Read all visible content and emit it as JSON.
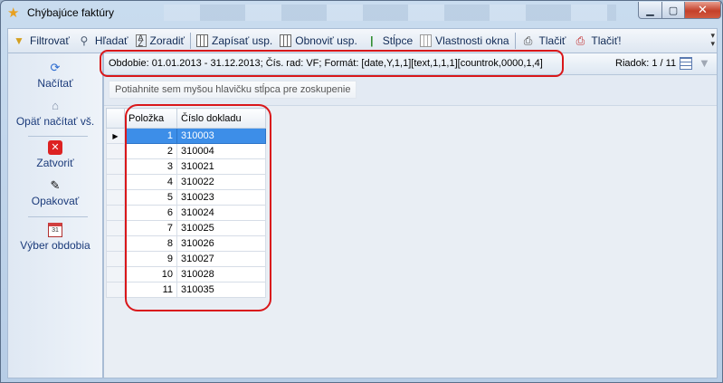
{
  "window": {
    "title": "Chýbajúce faktúry"
  },
  "toolbar": {
    "items": [
      {
        "label": "Filtrovať",
        "icon": "filter-icon"
      },
      {
        "label": "Hľadať",
        "icon": "search-icon"
      },
      {
        "label": "Zoradiť",
        "icon": "sort-icon"
      },
      {
        "label": "Zapísať usp.",
        "icon": "save-layout-icon"
      },
      {
        "label": "Obnoviť usp.",
        "icon": "restore-layout-icon"
      },
      {
        "label": "Stĺpce",
        "icon": "columns-icon"
      },
      {
        "label": "Vlastnosti okna",
        "icon": "window-properties-icon"
      },
      {
        "label": "Tlačiť",
        "icon": "print-icon"
      },
      {
        "label": "Tlačiť!",
        "icon": "print-direct-icon"
      }
    ]
  },
  "sidebar": {
    "items": [
      {
        "label": "Načítať",
        "icon": "load-icon"
      },
      {
        "label": "Opäť načítať vš.",
        "icon": "reload-all-icon"
      },
      {
        "label": "Zatvoriť",
        "icon": "close-icon"
      },
      {
        "label": "Opakovať",
        "icon": "repeat-icon"
      },
      {
        "label": "Výber obdobia",
        "icon": "calendar-icon"
      }
    ]
  },
  "info": {
    "text": "Obdobie: 01.01.2013 - 31.12.2013;  Čís. rad: VF; Formát: [date,Y,1,1][text,1,1,1][countrok,0000,1,4]",
    "row_indicator": "Riadok: 1 / 11"
  },
  "group_hint": "Potiahnite sem myšou hlavičku stĺpca pre zoskupenie",
  "table": {
    "columns": [
      "Položka",
      "Číslo dokladu"
    ],
    "rows": [
      [
        "1",
        "310003"
      ],
      [
        "2",
        "310004"
      ],
      [
        "3",
        "310021"
      ],
      [
        "4",
        "310022"
      ],
      [
        "5",
        "310023"
      ],
      [
        "6",
        "310024"
      ],
      [
        "7",
        "310025"
      ],
      [
        "8",
        "310026"
      ],
      [
        "9",
        "310027"
      ],
      [
        "10",
        "310028"
      ],
      [
        "11",
        "310035"
      ]
    ],
    "current_row": 1
  },
  "colors": {
    "selection": "#3d8ee8",
    "annotation": "#d9171a",
    "close_button": "#c4402a"
  }
}
